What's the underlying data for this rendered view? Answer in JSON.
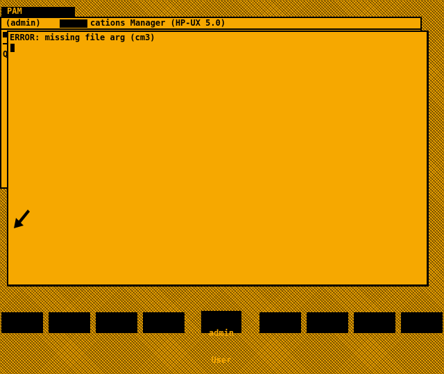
{
  "app": {
    "tab_label": "PAM"
  },
  "back_window": {
    "user_label": "(admin)",
    "title": "cations Manager (HP-UX 5.0)",
    "partial_glyph": "Q"
  },
  "front_window": {
    "message": "ERROR: missing file arg (cm3)"
  },
  "softkeys": {
    "user_key": {
      "line1": "admin",
      "line2": "User"
    }
  },
  "colors": {
    "background": "#f6a800",
    "ink": "#000000"
  },
  "icons": {
    "pointer": "arrow-pointer-icon"
  }
}
